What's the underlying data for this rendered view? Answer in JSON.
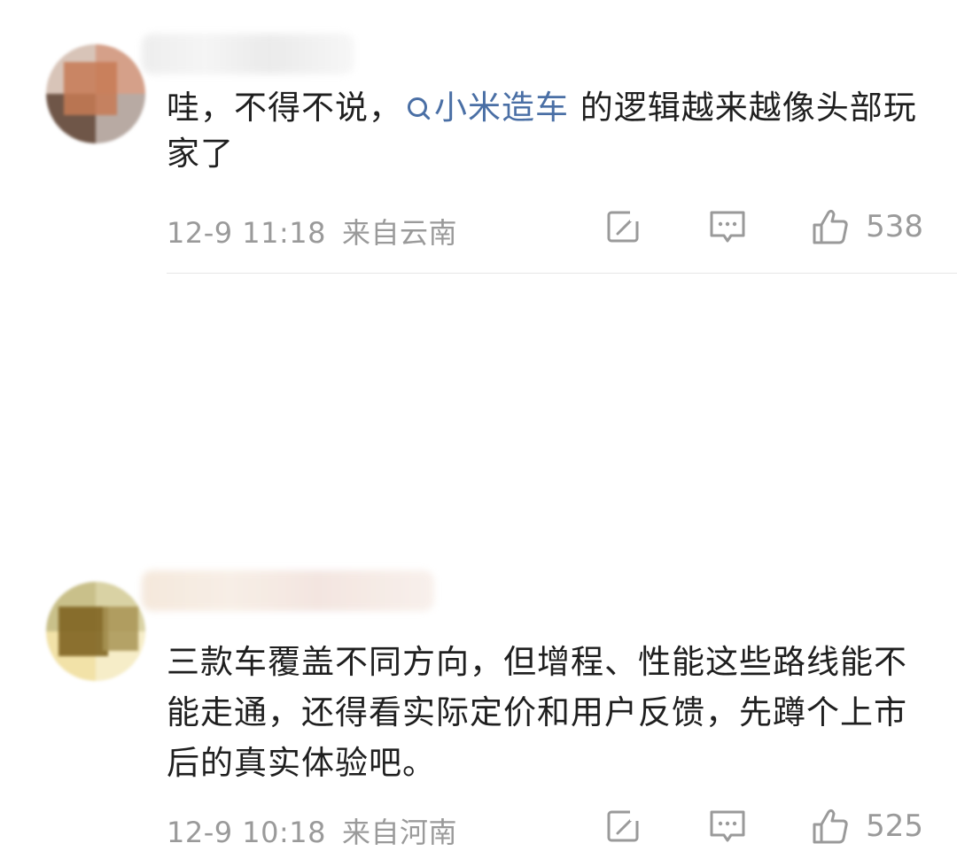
{
  "comments": [
    {
      "text_parts": {
        "before": "哇，不得不说，",
        "topic": "小米造车",
        "after": " 的逻辑越来越像头部玩家了"
      },
      "date": "12-9 11:18",
      "location": "来自云南",
      "likes": "538",
      "icons": [
        "share-icon",
        "comment-icon",
        "like-icon"
      ]
    },
    {
      "text": "三款车覆盖不同方向，但增程、性能这些路线能不能走通，还得看实际定价和用户反馈，先蹲个上市后的真实体验吧。",
      "date": "12-9 10:18",
      "location": "来自河南",
      "likes": "525",
      "icons": [
        "share-icon",
        "comment-icon",
        "like-icon"
      ]
    }
  ],
  "colors": {
    "topic_link": "#4a6fa5",
    "meta_text": "#9a9a9a",
    "body_text": "#1f1f1f"
  }
}
